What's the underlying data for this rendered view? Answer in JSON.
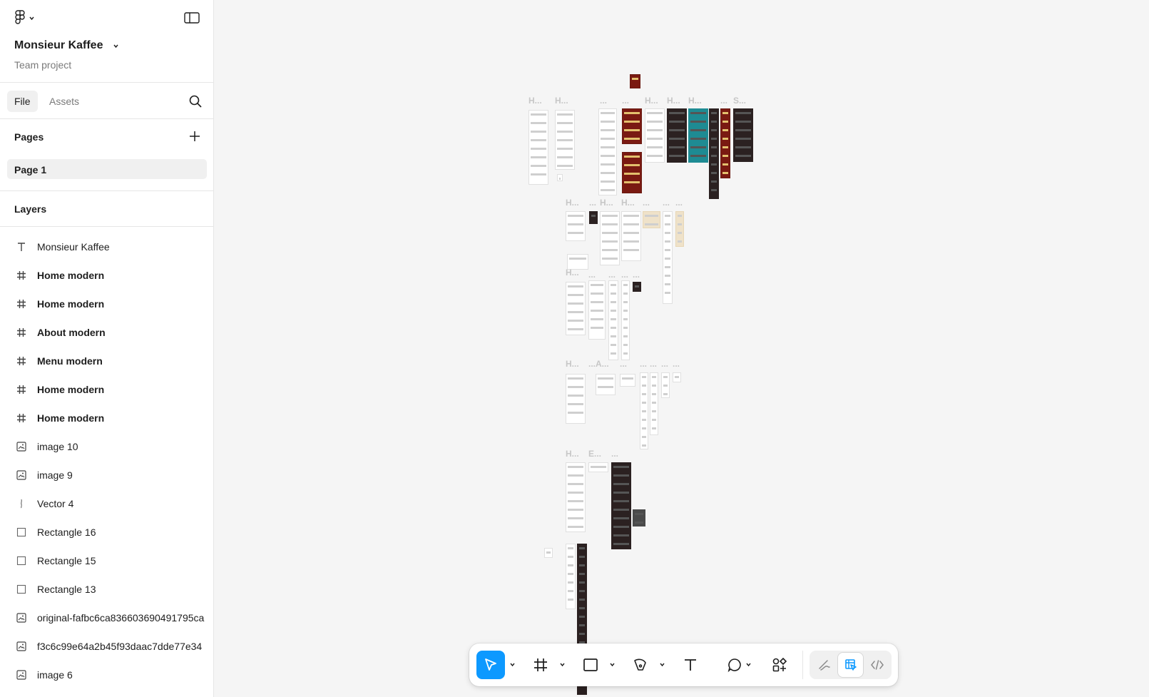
{
  "project": {
    "name": "Monsieur Kaffee",
    "subtitle": "Team project"
  },
  "tabs": {
    "file": "File",
    "assets": "Assets"
  },
  "pages": {
    "title": "Pages",
    "items": [
      "Page 1"
    ]
  },
  "layers": {
    "title": "Layers",
    "items": [
      {
        "label": "Monsieur Kaffee",
        "type": "text"
      },
      {
        "label": "Home modern",
        "type": "frame"
      },
      {
        "label": "Home modern",
        "type": "frame"
      },
      {
        "label": "About modern",
        "type": "frame"
      },
      {
        "label": "Menu modern",
        "type": "frame"
      },
      {
        "label": "Home modern",
        "type": "frame"
      },
      {
        "label": "Home modern",
        "type": "frame"
      },
      {
        "label": "image 10",
        "type": "image"
      },
      {
        "label": "image 9",
        "type": "image"
      },
      {
        "label": "Vector 4",
        "type": "vector"
      },
      {
        "label": "Rectangle 16",
        "type": "rect"
      },
      {
        "label": "Rectangle 15",
        "type": "rect"
      },
      {
        "label": "Rectangle 13",
        "type": "rect"
      },
      {
        "label": "original-fafbc6ca836603690491795ca",
        "type": "image"
      },
      {
        "label": "f3c6c99e64a2b45f93daac7dde77e34",
        "type": "image"
      },
      {
        "label": "image 6",
        "type": "image"
      }
    ]
  },
  "canvas_labels": {
    "r1": [
      "H...",
      "H...",
      "...",
      "...",
      "H...",
      "H...",
      "H...",
      "...",
      "S..."
    ],
    "r2": [
      "H...",
      "...",
      "H...",
      "H...",
      "...",
      "...",
      "..."
    ],
    "r3": [
      "H...",
      "...",
      "...",
      "...",
      "..."
    ],
    "r4": [
      "H...",
      "...A...",
      "...",
      "...",
      "...",
      "...",
      "..."
    ],
    "r5": [
      "H...",
      "E...",
      "..."
    ]
  },
  "toolbar": {
    "tools": [
      "move-tool",
      "frame-tool",
      "rectangle-tool",
      "pen-tool",
      "text-tool",
      "comment-tool",
      "actions-tool"
    ],
    "modes": [
      "draw-mode",
      "design-mode",
      "dev-mode"
    ]
  },
  "colors": {
    "accent": "#0d99ff",
    "canvas": "#f5f5f5",
    "sidebar": "#ffffff"
  }
}
